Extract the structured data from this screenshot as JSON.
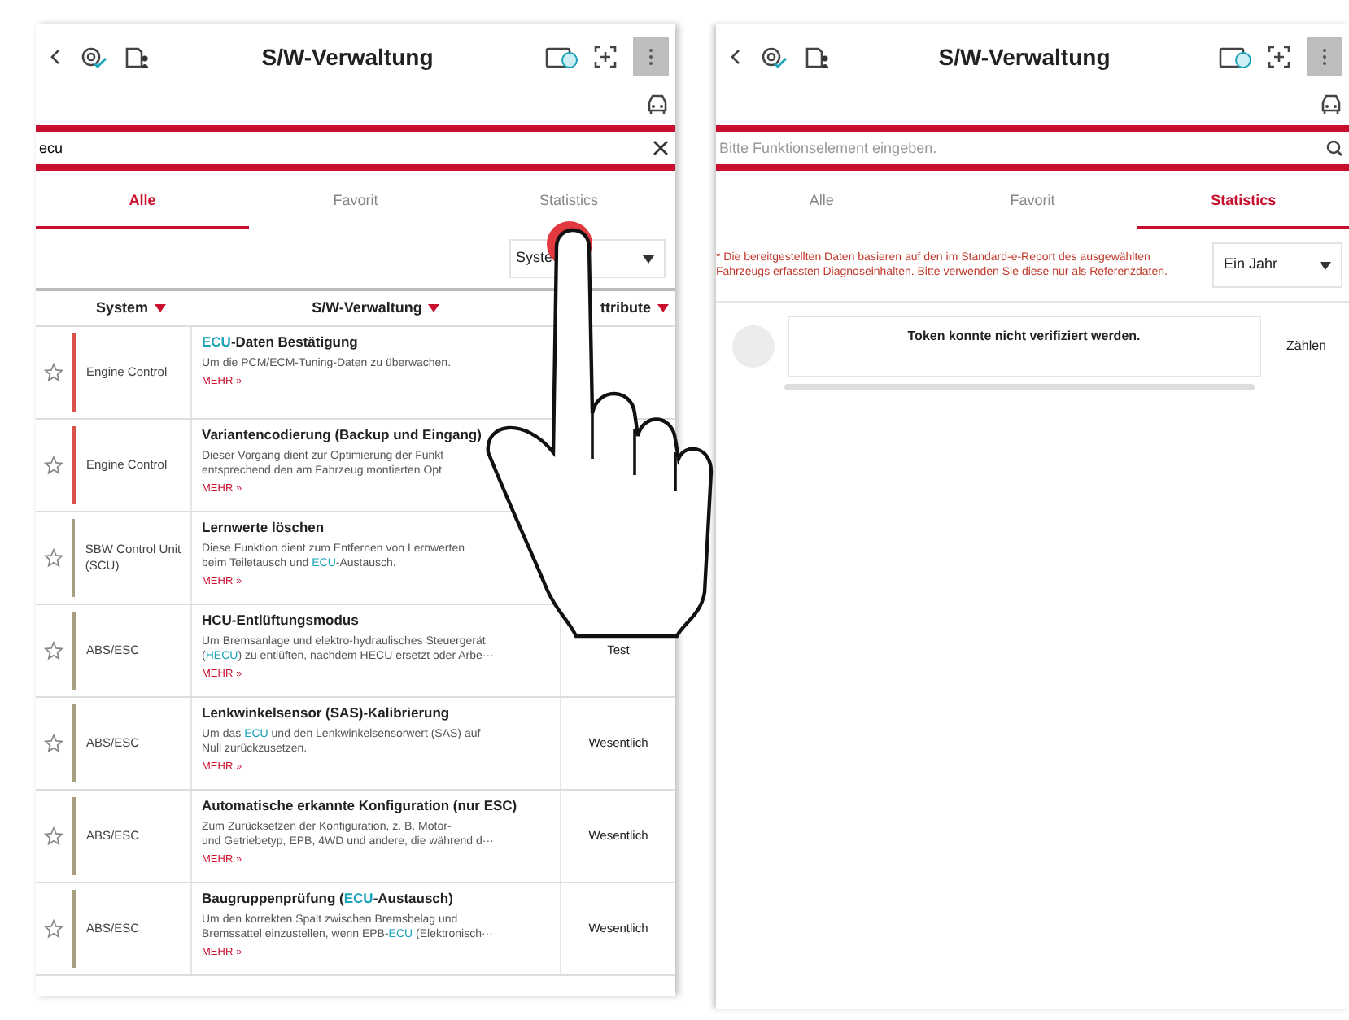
{
  "left_screen": {
    "title": "S/W-Verwaltung",
    "search": {
      "value": "ecu"
    },
    "tabs": [
      {
        "label": "Alle",
        "selected": true
      },
      {
        "label": "Favorit",
        "selected": false
      },
      {
        "label": "Statistics",
        "selected": false
      }
    ],
    "filter_select": "Syste",
    "table": {
      "columns": [
        "System",
        "S/W-Verwaltung",
        "ttribute"
      ],
      "rows": [
        {
          "favorite": false,
          "color": "#d9534a",
          "system": "Engine Control",
          "title": [
            {
              "text": "ECU",
              "highlight": true
            },
            {
              "text": "-Daten Bestätigung",
              "highlight": false
            }
          ],
          "description": [
            [
              {
                "text": "Um die PCM/ECM-Tuning-Daten zu überwachen.",
                "highlight": false
              }
            ]
          ],
          "more": "MEHR »",
          "attribute": ""
        },
        {
          "favorite": false,
          "color": "#d9534a",
          "system": "Engine Control",
          "title": [
            {
              "text": "Variantencodierung (Backup und Eingang)",
              "highlight": false
            }
          ],
          "description": [
            [
              {
                "text": "Dieser Vorgang dient zur Optimierung der Funkt",
                "highlight": false
              }
            ],
            [
              {
                "text": "entsprechend den am Fahrzeug montierten Opt",
                "highlight": false
              }
            ]
          ],
          "more": "MEHR »",
          "attribute": ""
        },
        {
          "favorite": false,
          "color": "#a89f80",
          "system": "SBW Control Unit (SCU)",
          "title": [
            {
              "text": "Lernwerte löschen",
              "highlight": false
            }
          ],
          "description": [
            [
              {
                "text": "Diese Funktion dient zum Entfernen von Lernwerten",
                "highlight": false
              }
            ],
            [
              {
                "text": "beim Teiletausch und ",
                "highlight": false
              },
              {
                "text": "ECU",
                "highlight": true
              },
              {
                "text": "-Austausch.",
                "highlight": false
              }
            ]
          ],
          "more": "MEHR »",
          "attribute": ""
        },
        {
          "favorite": false,
          "color": "#a89f80",
          "system": "ABS/ESC",
          "title": [
            {
              "text": "HCU-Entlüftungsmodus",
              "highlight": false
            }
          ],
          "description": [
            [
              {
                "text": "Um Bremsanlage und elektro-hydraulisches Steuergerät",
                "highlight": false
              }
            ],
            [
              {
                "text": "(",
                "highlight": false
              },
              {
                "text": "HECU",
                "highlight": true
              },
              {
                "text": ") zu entlüften, nachdem HECU ersetzt oder Arbe···",
                "highlight": false
              }
            ]
          ],
          "more": "MEHR »",
          "attribute": "Test"
        },
        {
          "favorite": false,
          "color": "#a89f80",
          "system": "ABS/ESC",
          "title": [
            {
              "text": "Lenkwinkelsensor (SAS)-Kalibrierung",
              "highlight": false
            }
          ],
          "description": [
            [
              {
                "text": "Um das ",
                "highlight": false
              },
              {
                "text": "ECU",
                "highlight": true
              },
              {
                "text": " und den Lenkwinkelsensorwert (SAS) auf",
                "highlight": false
              }
            ],
            [
              {
                "text": "Null zurückzusetzen.",
                "highlight": false
              }
            ]
          ],
          "more": "MEHR »",
          "attribute": "Wesentlich"
        },
        {
          "favorite": false,
          "color": "#a89f80",
          "system": "ABS/ESC",
          "title": [
            {
              "text": "Automatische erkannte Konfiguration (nur ESC)",
              "highlight": false
            }
          ],
          "description": [
            [
              {
                "text": "Zum Zurücksetzen der Konfiguration, z. B. Motor-",
                "highlight": false
              }
            ],
            [
              {
                "text": "und Getriebetyp, EPB, 4WD und andere, die während d···",
                "highlight": false
              }
            ]
          ],
          "more": "MEHR »",
          "attribute": "Wesentlich"
        },
        {
          "favorite": false,
          "color": "#a89f80",
          "system": "ABS/ESC",
          "title": [
            {
              "text": "Baugruppenprüfung (",
              "highlight": false
            },
            {
              "text": "ECU",
              "highlight": true
            },
            {
              "text": "-Austausch)",
              "highlight": false
            }
          ],
          "description": [
            [
              {
                "text": "Um den korrekten Spalt zwischen Bremsbelag und",
                "highlight": false
              }
            ],
            [
              {
                "text": "Bremssattel einzustellen, wenn EPB-",
                "highlight": false
              },
              {
                "text": "ECU",
                "highlight": true
              },
              {
                "text": " (Elektronisch···",
                "highlight": false
              }
            ]
          ],
          "more": "MEHR »",
          "attribute": "Wesentlich"
        }
      ]
    }
  },
  "right_screen": {
    "title": "S/W-Verwaltung",
    "search": {
      "placeholder": "Bitte Funktionselement eingeben."
    },
    "tabs": [
      {
        "label": "Alle",
        "selected": false
      },
      {
        "label": "Favorit",
        "selected": false
      },
      {
        "label": "Statistics",
        "selected": true
      }
    ],
    "note": "* Die bereitgestellten Daten basieren auf den im Standard-e-Report des ausgewählten Fahrzeugs erfassten Diagnoseinhalten. Bitte verwenden Sie diese nur als Referenzdaten.",
    "period_select": "Ein Jahr",
    "message": "Token konnte nicht verifiziert werden.",
    "count_label": "Zählen"
  }
}
